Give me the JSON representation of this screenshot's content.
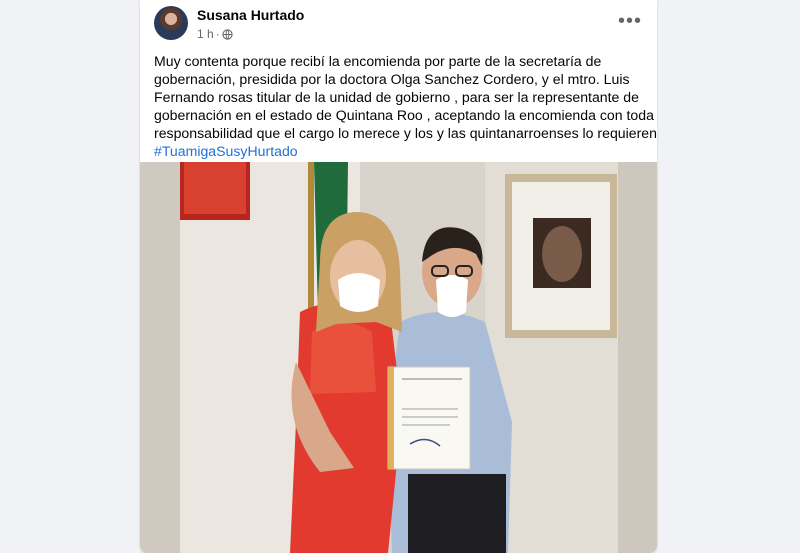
{
  "post": {
    "author": "Susana Hurtado",
    "time": "1 h",
    "separator": "·",
    "text_lines": [
      "Muy contenta porque recibí la encomienda por parte de la secretaría de",
      "gobernación, presidida por la doctora Olga Sanchez Cordero, y el mtro. Luis",
      "Fernando rosas titular de la unidad de gobierno , para ser la representante de",
      "gobernación en el estado de Quintana Roo , aceptando la encomienda con toda la",
      "responsabilidad que el cargo lo merece y los y las quintanarroenses lo requieren."
    ],
    "hashtag": "#TuamigaSusyHurtado"
  },
  "icons": {
    "privacy": "globe-icon",
    "menu": "more-horizontal-icon"
  },
  "colors": {
    "link": "#216fdb",
    "secondary_text": "#65676b",
    "background": "#f0f2f5"
  }
}
